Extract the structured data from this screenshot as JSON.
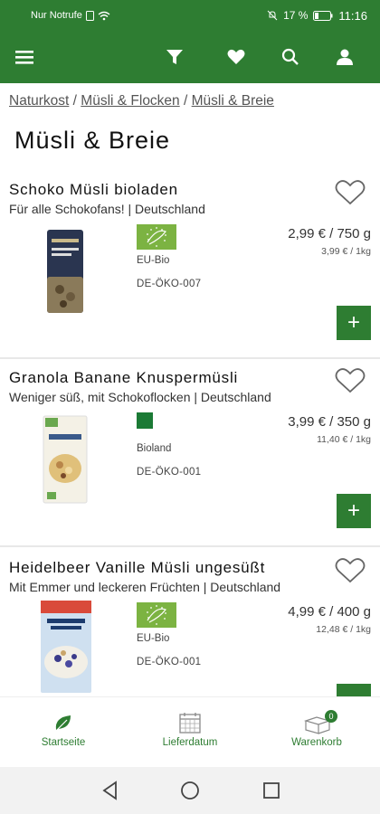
{
  "status_bar": {
    "left_text": "Nur Notrufe",
    "battery": "17 %",
    "time": "11:16"
  },
  "app_bar": {
    "icons": [
      "menu-icon",
      "filter-icon",
      "heart-icon",
      "search-icon",
      "user-icon"
    ]
  },
  "breadcrumb": {
    "items": [
      "Naturkost",
      "Müsli & Flocken",
      "Müsli & Breie"
    ],
    "separator": "/"
  },
  "page_title": "Müsli & Breie",
  "products": [
    {
      "name": "Schoko Müsli bioladen",
      "description": "Für alle Schokofans! | Deutschland",
      "badge": "EU-Bio",
      "code": "DE-ÖKO-007",
      "price": "2,99 € / 750 g",
      "unit_price": "3,99 € / 1kg",
      "add_label": "+"
    },
    {
      "name": "Granola Banane Knuspermüsli",
      "description": "Weniger süß, mit Schokoflocken | Deutschland",
      "badge": "Bioland",
      "code": "DE-ÖKO-001",
      "price": "3,99 € / 350 g",
      "unit_price": "11,40 € / 1kg",
      "add_label": "+"
    },
    {
      "name": "Heidelbeer Vanille Müsli ungesüßt",
      "description": "Mit Emmer und leckeren Früchten | Deutschland",
      "badge": "EU-Bio",
      "code": "DE-ÖKO-001",
      "price": "4,99 € / 400 g",
      "unit_price": "12,48 € / 1kg",
      "add_label": "+"
    }
  ],
  "bottom_nav": {
    "items": [
      {
        "label": "Startseite",
        "icon": "leaf-icon"
      },
      {
        "label": "Lieferdatum",
        "icon": "calendar-icon"
      },
      {
        "label": "Warenkorb",
        "icon": "cart-icon"
      }
    ],
    "cart_count": "0"
  },
  "colors": {
    "primary": "#2e7d32",
    "eu_bio": "#7cb342",
    "bioland": "#1b7a35"
  }
}
